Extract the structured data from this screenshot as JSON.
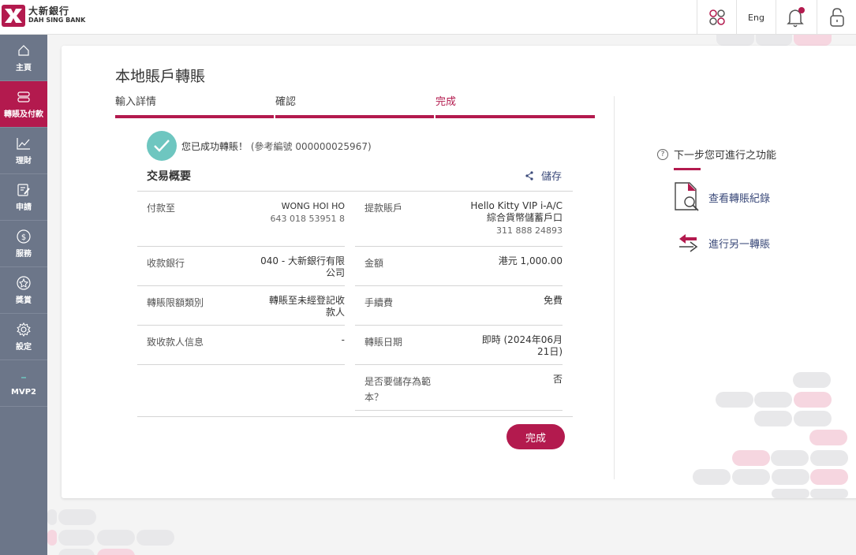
{
  "brand": {
    "name_cn": "大新銀行",
    "name_en": "DAH SING BANK",
    "color": "#b31a4e"
  },
  "header": {
    "lang_label": "Eng",
    "icons": [
      "apps-icon",
      "bell-icon",
      "lock-icon"
    ]
  },
  "sidebar": {
    "items": [
      {
        "label": "主頁",
        "icon": "home-icon"
      },
      {
        "label": "轉賬及付款",
        "icon": "transfer-icon",
        "active": true
      },
      {
        "label": "理財",
        "icon": "chart-icon"
      },
      {
        "label": "申請",
        "icon": "form-icon"
      },
      {
        "label": "服務",
        "icon": "dollar-icon"
      },
      {
        "label": "獎賞",
        "icon": "reward-icon"
      },
      {
        "label": "設定",
        "icon": "gear-icon"
      },
      {
        "label": "MVP2",
        "icon": "dash-icon"
      }
    ]
  },
  "page": {
    "title": "本地賬戶轉賬"
  },
  "steps": [
    {
      "label": "輸入詳情"
    },
    {
      "label": "確認"
    },
    {
      "label": "完成",
      "current": true
    }
  ],
  "success": {
    "message": "您已成功轉賬！",
    "reference": "(參考編號 000000025967)"
  },
  "summary": {
    "title": "交易概要",
    "save_label": "儲存",
    "left": [
      {
        "label": "付款至",
        "value": "WONG HOI HO",
        "sub": "643 018 53951 8"
      },
      {
        "label": "收款銀行",
        "value": "040 - 大新銀行有限",
        "value2": "公司"
      },
      {
        "label": "轉賬限額類別",
        "value": "轉賬至未經登記收",
        "value2": "款人"
      },
      {
        "label": "致收款人信息",
        "value": "-"
      }
    ],
    "right": [
      {
        "label": "提款賬戶",
        "value": "Hello Kitty VIP i-A/C",
        "value2": "綜合貨幣儲蓄戶口",
        "sub": "311 888 24893"
      },
      {
        "label": "金額",
        "value": "港元 1,000.00"
      },
      {
        "label": "手續費",
        "value": "免費"
      },
      {
        "label": "轉賬日期",
        "value": "即時 (2024年06月",
        "value2": "21日)"
      },
      {
        "label": "是否要儲存為範",
        "label2": "本？",
        "value": "否"
      }
    ]
  },
  "done_button": "完成",
  "next_steps": {
    "title": "下一步您可進行之功能",
    "items": [
      {
        "label": "查看轉賬紀錄",
        "icon": "document-search-icon"
      },
      {
        "label": "進行另一轉賬",
        "icon": "transfer-arrows-icon"
      }
    ]
  }
}
